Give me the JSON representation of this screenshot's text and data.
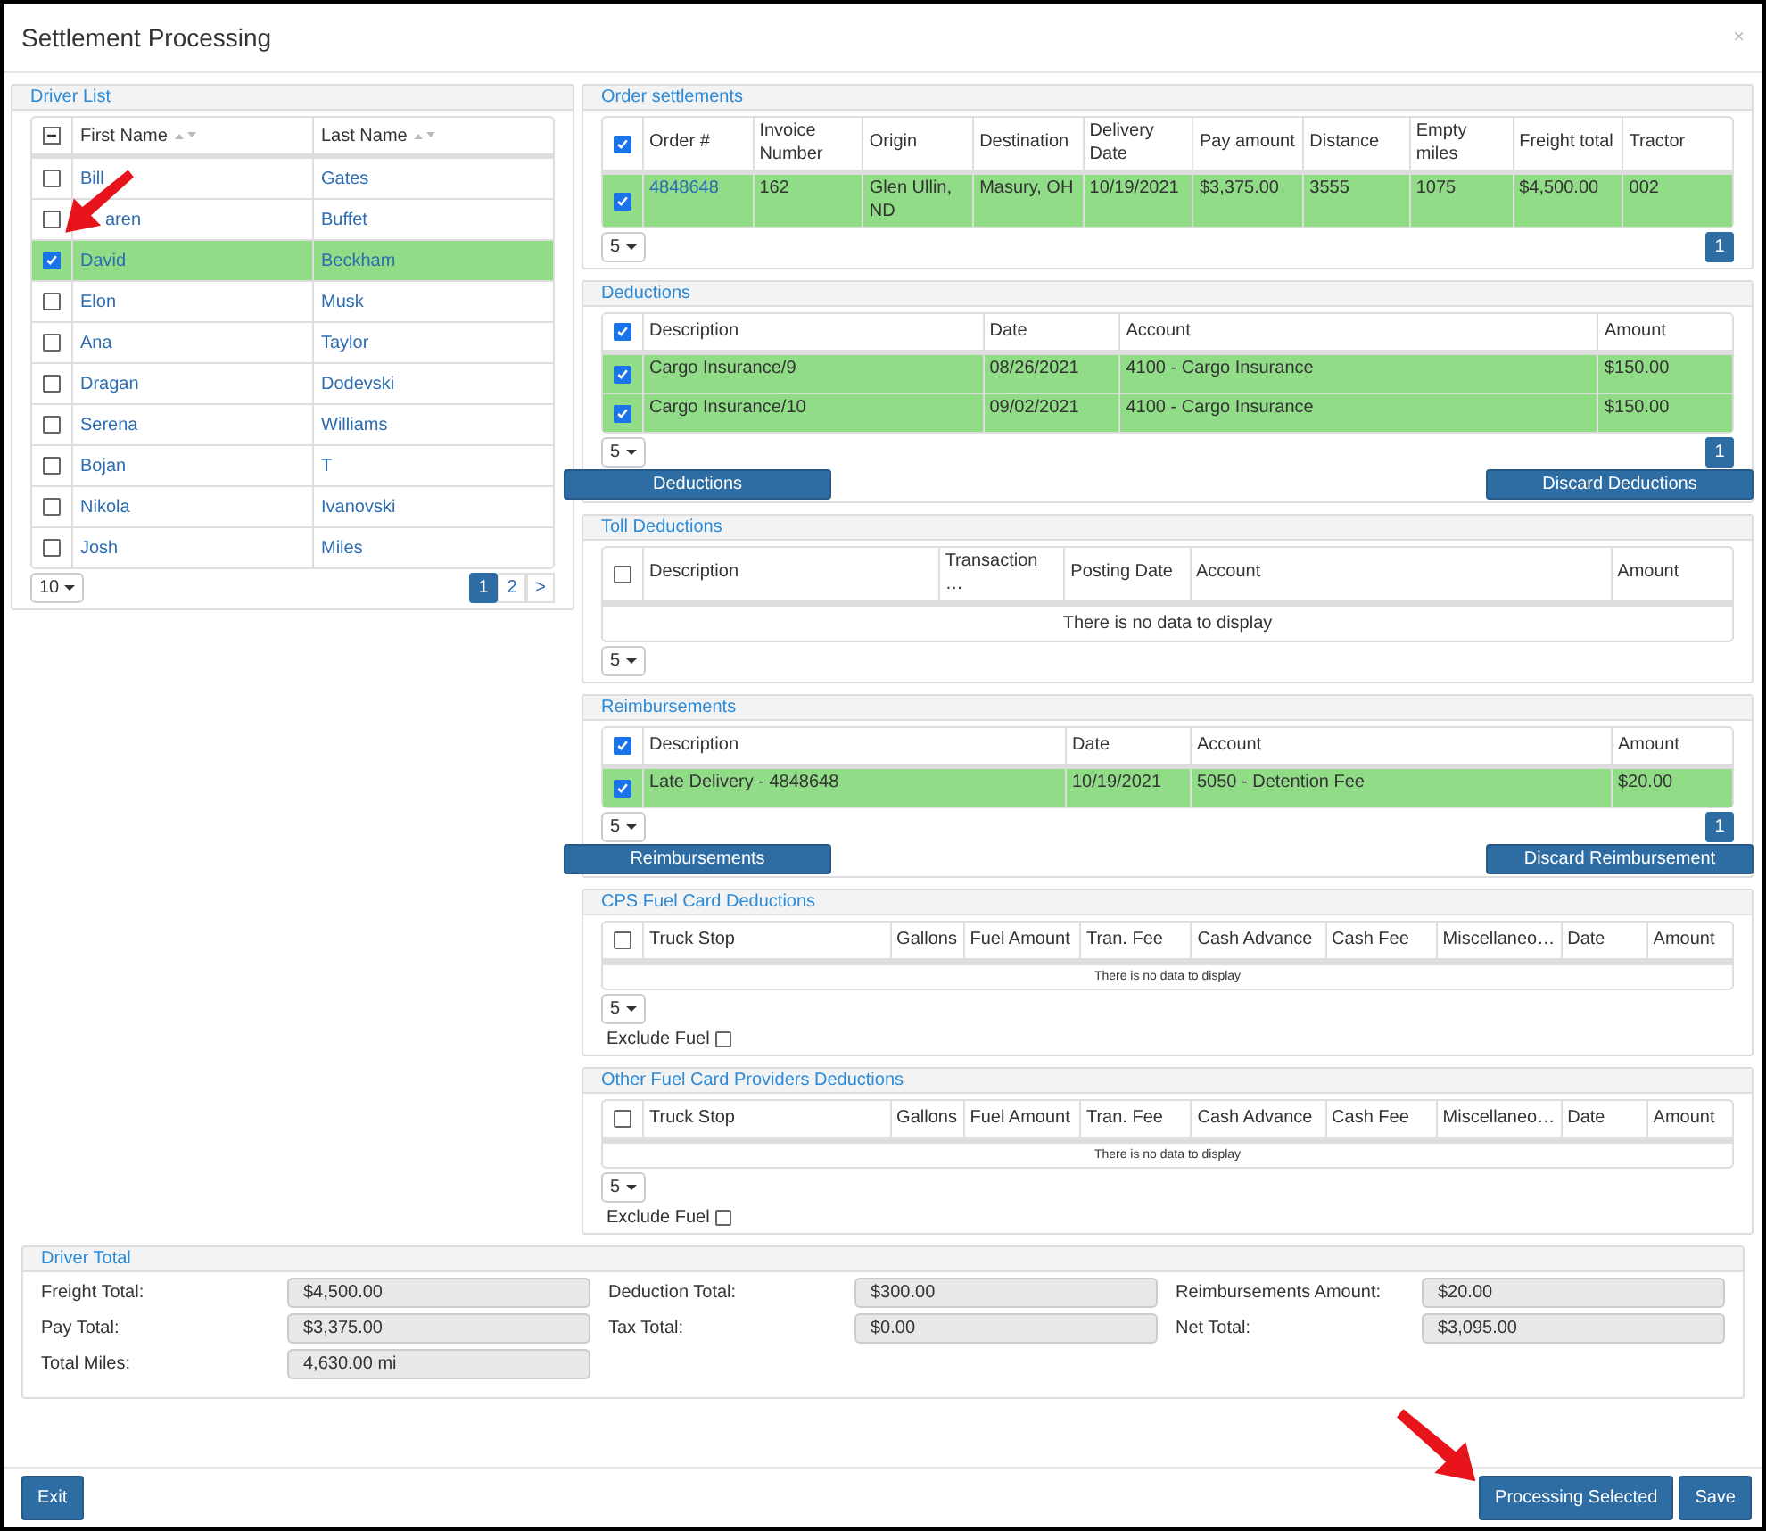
{
  "window": {
    "title": "Settlement Processing",
    "close": "×"
  },
  "driver_list": {
    "title": "Driver List",
    "columns": [
      "First Name",
      "Last Name"
    ],
    "rows": [
      {
        "first": "Bill",
        "last": "Gates",
        "checked": false,
        "selected": false
      },
      {
        "first": "aren",
        "last": "Buffet",
        "checked": false,
        "selected": false
      },
      {
        "first": "David",
        "last": "Beckham",
        "checked": true,
        "selected": true
      },
      {
        "first": "Elon",
        "last": "Musk",
        "checked": false,
        "selected": false
      },
      {
        "first": "Ana",
        "last": "Taylor",
        "checked": false,
        "selected": false
      },
      {
        "first": "Dragan",
        "last": "Dodevski",
        "checked": false,
        "selected": false
      },
      {
        "first": "Serena",
        "last": "Williams",
        "checked": false,
        "selected": false
      },
      {
        "first": "Bojan",
        "last": "T",
        "checked": false,
        "selected": false
      },
      {
        "first": "Nikola",
        "last": "Ivanovski",
        "checked": false,
        "selected": false
      },
      {
        "first": "Josh",
        "last": "Miles",
        "checked": false,
        "selected": false
      }
    ],
    "page_size": "10",
    "pages": [
      {
        "label": "1",
        "selected": true
      },
      {
        "label": "2",
        "selected": false
      },
      {
        "label": ">",
        "selected": false
      }
    ]
  },
  "sections": [
    {
      "title": "Order settlements",
      "all_checked": true,
      "columns": [
        "Order #",
        "Invoice Number",
        "Origin",
        "Destination",
        "Delivery Date",
        "Pay amount",
        "Distance",
        "Empty miles",
        "Freight total",
        "Tractor"
      ],
      "rows": [
        {
          "checked": true,
          "selected": true,
          "first_is_link": true,
          "cells": [
            "4848648",
            "162",
            "Glen Ullin, ND",
            "Masury, OH",
            "10/19/2021",
            "$3,375.00",
            "3555",
            "1075",
            "$4,500.00",
            "002"
          ]
        }
      ],
      "page_size": "5",
      "pages": [
        {
          "label": "1",
          "selected": true
        }
      ]
    },
    {
      "title": "Deductions",
      "all_checked": true,
      "columns": [
        "Description",
        "Date",
        "Account",
        "Amount"
      ],
      "rows": [
        {
          "checked": true,
          "selected": true,
          "cells": [
            "Cargo Insurance/9",
            "08/26/2021",
            "4100 - Cargo Insurance",
            "$150.00"
          ]
        },
        {
          "checked": true,
          "selected": true,
          "cells": [
            "Cargo Insurance/10",
            "09/02/2021",
            "4100 - Cargo Insurance",
            "$150.00"
          ]
        }
      ],
      "page_size": "5",
      "pages": [
        {
          "label": "1",
          "selected": true
        }
      ],
      "buttons": [
        "Deductions",
        "Discard Deductions"
      ]
    },
    {
      "title": "Toll Deductions",
      "all_checked": false,
      "columns": [
        "Description",
        "Transaction …",
        "Posting Date",
        "Account",
        "Amount"
      ],
      "empty_message": "There is no data to display",
      "page_size": "5"
    },
    {
      "title": "Reimbursements",
      "all_checked": true,
      "columns": [
        "Description",
        "Date",
        "Account",
        "Amount"
      ],
      "rows": [
        {
          "checked": true,
          "selected": true,
          "cells": [
            "Late Delivery - 4848648",
            "10/19/2021",
            "5050 - Detention Fee",
            "$20.00"
          ]
        }
      ],
      "page_size": "5",
      "pages": [
        {
          "label": "1",
          "selected": true
        }
      ],
      "buttons": [
        "Reimbursements",
        "Discard Reimbursement"
      ]
    },
    {
      "title": "CPS Fuel Card Deductions",
      "all_checked": false,
      "columns": [
        "Truck Stop",
        "Gallons",
        "Fuel Amount",
        "Tran. Fee",
        "Cash Advance",
        "Cash Fee",
        "Miscellaneo…",
        "Date",
        "Amount"
      ],
      "empty_message": "There is no data to display",
      "page_size": "5",
      "exclude_fuel": {
        "label": "Exclude Fuel",
        "checked": false
      }
    },
    {
      "title": "Other Fuel Card Providers Deductions",
      "all_checked": false,
      "columns": [
        "Truck Stop",
        "Gallons",
        "Fuel Amount",
        "Tran. Fee",
        "Cash Advance",
        "Cash Fee",
        "Miscellaneo…",
        "Date",
        "Amount"
      ],
      "empty_message": "There is no data to display",
      "page_size": "5",
      "exclude_fuel": {
        "label": "Exclude Fuel",
        "checked": false
      }
    }
  ],
  "driver_total": {
    "title": "Driver Total",
    "columns": [
      [
        {
          "label": "Freight Total:",
          "value": "$4,500.00"
        },
        {
          "label": "Pay Total:",
          "value": "$3,375.00"
        },
        {
          "label": "Total Miles:",
          "value": "4,630.00 mi"
        }
      ],
      [
        {
          "label": "Deduction Total:",
          "value": "$300.00"
        },
        {
          "label": "Tax Total:",
          "value": "$0.00"
        }
      ],
      [
        {
          "label": "Reimbursements Amount:",
          "value": "$20.00"
        },
        {
          "label": "Net Total:",
          "value": "$3,095.00"
        }
      ]
    ]
  },
  "footer": {
    "left_buttons": [
      "Exit"
    ],
    "right_buttons": [
      "Processing Selected",
      "Save"
    ]
  }
}
